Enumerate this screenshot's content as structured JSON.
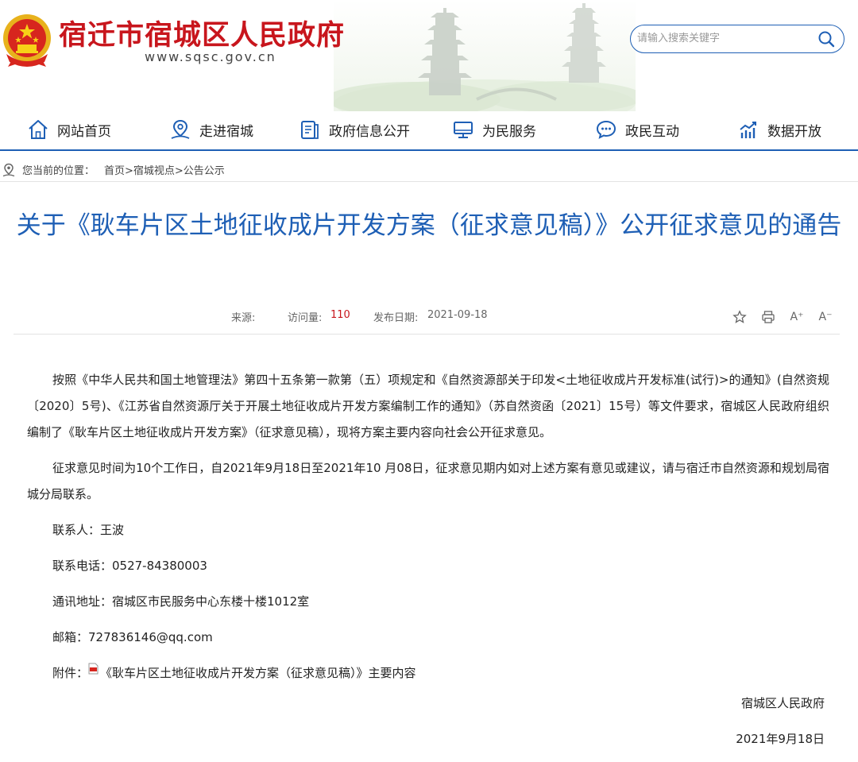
{
  "header": {
    "site_title": "宿迁市宿城区人民政府",
    "site_url": "www.sqsc.gov.cn",
    "search_placeholder": "请输入搜索关键字"
  },
  "nav": {
    "items": [
      {
        "label": "网站首页",
        "icon": "home-icon"
      },
      {
        "label": "走进宿城",
        "icon": "location-icon"
      },
      {
        "label": "政府信息公开",
        "icon": "document-icon"
      },
      {
        "label": "为民服务",
        "icon": "monitor-icon"
      },
      {
        "label": "政民互动",
        "icon": "chat-icon"
      },
      {
        "label": "数据开放",
        "icon": "chart-icon"
      }
    ],
    "accent": "#1e5fb5"
  },
  "breadcrumb": {
    "label": "您当前的位置：",
    "path": "首页>宿城视点>公告公示"
  },
  "article": {
    "title": "关于《耿车片区土地征收成片开发方案（征求意见稿）》公开征求意见的通告",
    "source_label": "来源:",
    "views_label": "访问量:",
    "views": "110",
    "date_label": "发布日期:",
    "date": "2021-09-18",
    "tools": {
      "font_increase": "A⁺",
      "font_decrease": "A⁻"
    },
    "paragraphs": [
      "按照《中华人民共和国土地管理法》第四十五条第一款第（五）项规定和《自然资源部关于印发<土地征收成片开发标准(试行)>的通知》(自然资规〔2020〕5号)、《江苏省自然资源厅关于开展土地征收成片开发方案编制工作的通知》（苏自然资函〔2021〕15号）等文件要求，宿城区人民政府组织编制了《耿车片区土地征收成片开发方案》（征求意见稿），现将方案主要内容向社会公开征求意见。",
      "征求意见时间为10个工作日，自2021年9月18日至2021年10 月08日，征求意见期内如对上述方案有意见或建议，请与宿迁市自然资源和规划局宿城分局联系。"
    ],
    "contact": "联系人：王波",
    "phone": "联系电话：0527-84380003",
    "address": "通讯地址：宿城区市民服务中心东楼十楼1012室",
    "email": "邮箱：727836146@qq.com",
    "attachment_label": "附件：",
    "attachment_name": "《耿车片区土地征收成片开发方案（征求意见稿）》主要内容",
    "signature": "宿城区人民政府",
    "sign_date": "2021年9月18日"
  },
  "colors": {
    "brand_red": "#c8161d",
    "title_blue": "#1e5fb5"
  }
}
